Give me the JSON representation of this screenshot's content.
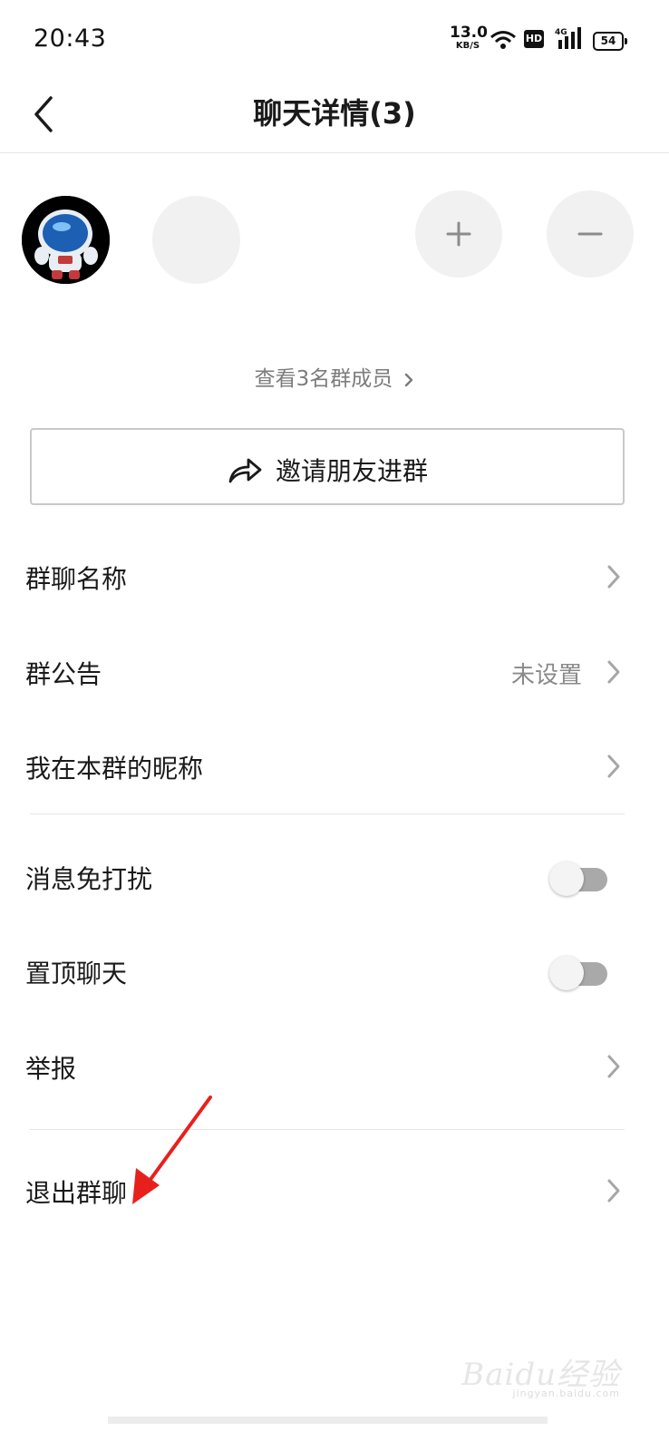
{
  "status_bar": {
    "time": "20:43",
    "net_speed": "13.0",
    "net_unit": "KB/S",
    "hd": "HD",
    "network": "4G",
    "battery": "54"
  },
  "header": {
    "title": "聊天详情(3)"
  },
  "members": {
    "view_all": "查看3名群成员"
  },
  "invite": {
    "label": "邀请朋友进群"
  },
  "settings": {
    "group_name": "群聊名称",
    "announcement": "群公告",
    "announcement_value": "未设置",
    "my_nickname": "我在本群的昵称",
    "mute": "消息免打扰",
    "mute_on": false,
    "pin": "置顶聊天",
    "pin_on": false,
    "report": "举报",
    "leave": "退出群聊"
  },
  "watermark": {
    "brand": "Baidu经验",
    "url": "jingyan.baidu.com"
  },
  "colors": {
    "annotation_arrow": "#e8201d",
    "toggle_off": "#a9a9a9"
  }
}
